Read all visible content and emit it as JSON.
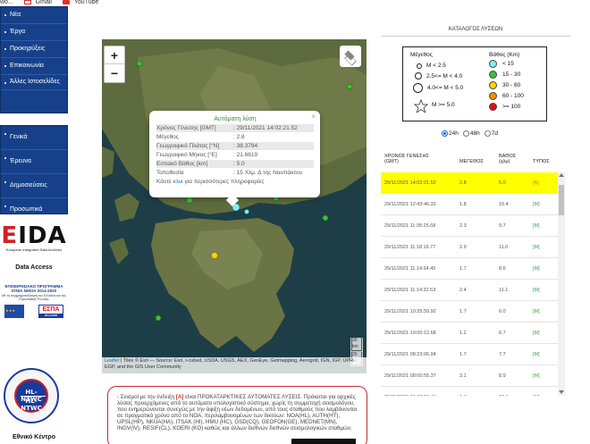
{
  "bookmarks": {
    "partial": "wo...",
    "gmail": "Gmail",
    "youtube": "YouTube"
  },
  "sidebar": {
    "menu1": [
      "Νέα",
      "Έργα",
      "Προκηρύξεις",
      "Επικοινωνία",
      "Άλλες Ιστοσελίδες"
    ],
    "menu2": [
      "Γενικά",
      "Έρευνα",
      "Δημοσιεύσεις",
      "Προσωπικά"
    ],
    "eida_logo": "EIDA",
    "eida_sub": "European Integrated Data Archives",
    "data_access": "Data Access",
    "espa_title": "ΕΠΙΧΕΙΡΗΣΙΑΚΟ ΠΡΟΓΡΑΜΜΑ ΙΟΝΙΑ ΝΗΣΙΑ 2014-2020",
    "espa_sub": "Με τη συγχρηματοδότηση της Ελλάδας και της Ευρωπαϊκής Ένωσης",
    "espa_logo": "ΕΣΠΑ",
    "espa_years": "2014-2020",
    "ntwc_label": "HL-NTWC",
    "bottom_text": "Εθνικό Κέντρο"
  },
  "map": {
    "zoom_in": "+",
    "zoom_out": "−",
    "scale_km": "30 km",
    "scale_mi": "20 mi",
    "attribution_leaflet": "Leaflet",
    "attribution_text": " | Tiles © Esri — Source: Esri, i-cubed, USDA, USGS, AEX, GeoEye, Getmapping, Aerogrid, IGN, IGP, UPR-EGP, and the GIS User Community"
  },
  "popup": {
    "close": "×",
    "title": "Αυτόματη λύση",
    "rows": [
      {
        "k": "Χρόνος Γένεσης [GMT]",
        "v": ": 29/11/2021 14:02:21.52"
      },
      {
        "k": "Μέγεθος",
        "v": ": 2.8"
      },
      {
        "k": "Γεωγραφικό Πλάτος [°N]",
        "v": ": 38.3794"
      },
      {
        "k": "Γεωγραφικό Μήκος [°E]",
        "v": ": 21.6619"
      },
      {
        "k": "Εστιακό Βάθος [km]",
        "v": ": 5.0"
      },
      {
        "k": "Τοποθεσία",
        "v": ": 15 Χλμ. Δ της Ναυπάκτου"
      }
    ],
    "footer_pre": "Κάντε ",
    "footer_link": "κλικ",
    "footer_post": " για περισσότερες πληροφορίες"
  },
  "catalog": {
    "title": "ΚΑΤΑΛΟΓΟΣ ΛΥΣΕΩΝ",
    "legend": {
      "mag_header": "Μέγεθος",
      "depth_header": "Βάθος (Km)",
      "magnitudes": [
        "M < 2.5",
        "2.5<= M < 4.0",
        "4.0<= M < 5.0",
        "M >= 5.0"
      ],
      "depths": [
        {
          "label": "< 15",
          "color": "#7ff0f0"
        },
        {
          "label": "15 - 30",
          "color": "#3ac23a"
        },
        {
          "label": "30 - 60",
          "color": "#ffd400"
        },
        {
          "label": "60 - 100",
          "color": "#ff8c00"
        },
        {
          "label": ">= 100",
          "color": "#e01010"
        }
      ]
    },
    "period_options": [
      {
        "label": "24h",
        "selected": true
      },
      {
        "label": "48h",
        "selected": false
      },
      {
        "label": "7d",
        "selected": false
      }
    ],
    "columns": {
      "time": "ΧΡΟΝΟΣ ΓΕΝΕΣΗΣ (GMT)",
      "mag": "ΜΕΓΕΘΟΣ",
      "depth": "ΒΑΘΟΣ (χλμ)",
      "type": "ΤΥΠΟΣ"
    },
    "rows": [
      {
        "time": "29/11/2021 14:02:21.52",
        "mag": "2.8",
        "depth": "5.0",
        "type": "[A]"
      },
      {
        "time": "29/11/2021 12:43:46.32",
        "mag": "1.8",
        "depth": "10.4",
        "type": "[M]"
      },
      {
        "time": "29/11/2021 11:35:25.68",
        "mag": "2.3",
        "depth": "9.7",
        "type": "[M]"
      },
      {
        "time": "29/11/2021 11:18:16.77",
        "mag": "2.9",
        "depth": "11.0",
        "type": "[M]"
      },
      {
        "time": "29/11/2021 11:14:34.45",
        "mag": "1.7",
        "depth": "8.6",
        "type": "[M]"
      },
      {
        "time": "29/11/2021 11:14:32.53",
        "mag": "2.4",
        "depth": "11.1",
        "type": "[M]"
      },
      {
        "time": "29/11/2021 10:25:59.92",
        "mag": "1.7",
        "depth": "6.0",
        "type": "[M]"
      },
      {
        "time": "29/11/2021 10:00:12.68",
        "mag": "1.2",
        "depth": "6.7",
        "type": "[M]"
      },
      {
        "time": "29/11/2021 08:23:06.94",
        "mag": "1.7",
        "depth": "7.7",
        "type": "[M]"
      },
      {
        "time": "29/11/2021 08:00:55.37",
        "mag": "3.1",
        "depth": "8.9",
        "type": "[M]"
      },
      {
        "time": "29/11/2021 06:37:26.49",
        "mag": "1.4",
        "depth": "10.6",
        "type": "[M]"
      }
    ]
  },
  "notice": {
    "pre": "- Σεισμοί με την ένδειξη ",
    "tag": "[A]",
    "text": " είναι ΠΡΟΚΑΤΑΡΚΤΙΚΕΣ ΑΥΤΟΜΑΤΕΣ ΛΥΣΕΙΣ. Πρόκειται για αρχικές λύσεις προερχόμενες από το αυτόματο υπολογιστικό σύστημα, χωρίς τη συμμετοχή σεισμολόγου, που ενημερώνονται συνεχώς με την άφιξη νέων δεδομένων, από τους σταθμούς που λαμβάνονται σε πραγματικό χρόνο από το NOA, περιλαμβανομένων των δικτύων: NOA(HL), AUTH(HT), UPSL(HP), NKUA(HA), ITSAK (HI), HMU (HC), GSD(CQ), GEOFON(GE), MEDNET(MN), INGV(IV), RESIF(CL), KOERI (KO) καθώς και άλλων διεθνών διεθνών σεισμολογικών σταθμών."
  },
  "colors": {
    "nav_blue": "#16418a",
    "highlight": "#ffff00",
    "notice_border": "#c03030",
    "popup_title": "#3a8c3a"
  }
}
